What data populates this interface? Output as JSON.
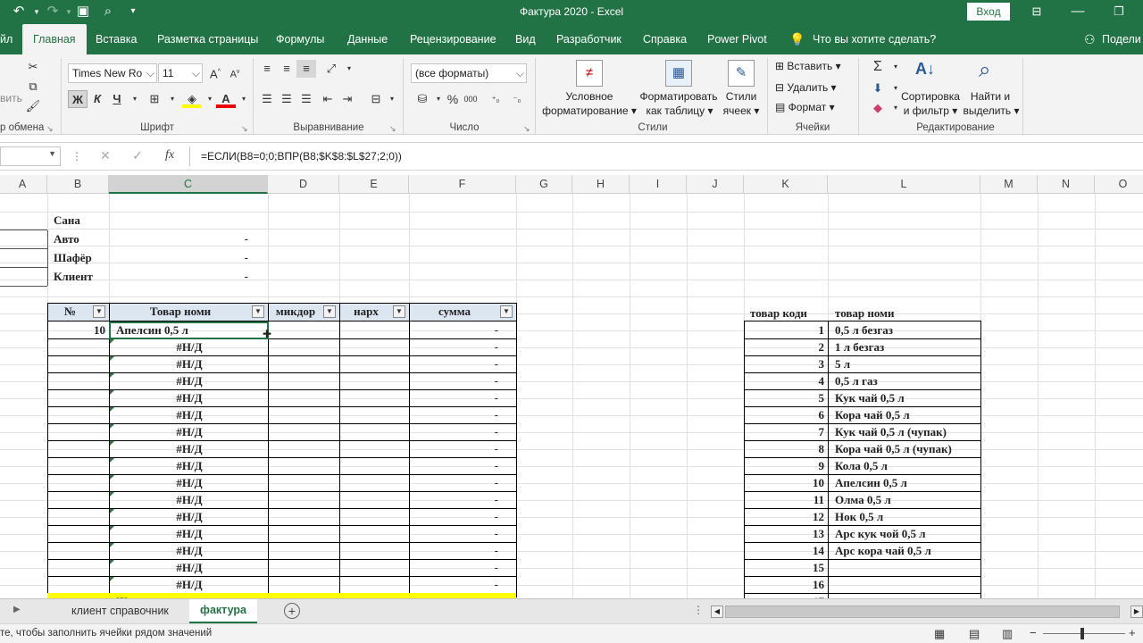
{
  "titlebar": {
    "title": "Фактура 2020  -  Excel",
    "signin": "Вход"
  },
  "ribbon_tabs": {
    "file_partial": "йл",
    "items": [
      "Главная",
      "Вставка",
      "Разметка страницы",
      "Формулы",
      "Данные",
      "Рецензирование",
      "Вид",
      "Разработчик",
      "Справка",
      "Power Pivot"
    ],
    "tellme": "Что вы хотите сделать?",
    "share": "Подели"
  },
  "ribbon": {
    "clipboard": {
      "paste_partial": "вить",
      "group": "р обмена"
    },
    "font": {
      "name": "Times New Ro",
      "size": "11",
      "bold": "Ж",
      "italic": "К",
      "underline": "Ч",
      "group": "Шрифт"
    },
    "alignment": {
      "group": "Выравнивание"
    },
    "number": {
      "format": "(все форматы)",
      "percent": "%",
      "thousands": "000",
      "group": "Число"
    },
    "styles": {
      "conditional": [
        "Условное",
        "форматирование"
      ],
      "as_table": [
        "Форматировать",
        "как таблицу"
      ],
      "cell_styles": [
        "Стили",
        "ячеек"
      ],
      "group": "Стили"
    },
    "cells": {
      "insert": "Вставить",
      "delete": "Удалить",
      "format": "Формат",
      "group": "Ячейки"
    },
    "editing": {
      "sort": [
        "Сортировка",
        "и фильтр"
      ],
      "find": [
        "Найти и",
        "выделить"
      ],
      "group": "Редактирование"
    }
  },
  "formula_bar": {
    "fx": "fx",
    "formula": "=ЕСЛИ(B8=0;0;ВПР(B8;$K$8:$L$27;2;0))"
  },
  "columns": [
    "A",
    "B",
    "C",
    "D",
    "E",
    "F",
    "G",
    "H",
    "I",
    "J",
    "K",
    "L",
    "M",
    "N",
    "O"
  ],
  "header_block": {
    "labels": [
      "Сана",
      "Авто",
      "Шафёр",
      "Клиент"
    ],
    "values": [
      "",
      "-",
      "-",
      "-"
    ]
  },
  "invoice_table": {
    "headers": [
      "№",
      "Товар номи",
      "микдор",
      "нарх",
      "сумма"
    ],
    "first_row": {
      "num": "10",
      "product": "Апелсин 0,5 л",
      "sum": "-"
    },
    "na_value": "#Н/Д",
    "dash_value": "-",
    "na_rows": 15,
    "total_label_partial": "Ж"
  },
  "product_table": {
    "headers": [
      "товар коди",
      "товар номи"
    ],
    "rows": [
      {
        "code": "1",
        "name": "0,5 л безгаз"
      },
      {
        "code": "2",
        "name": "1 л безгаз"
      },
      {
        "code": "3",
        "name": "5 л"
      },
      {
        "code": "4",
        "name": "0,5 л газ"
      },
      {
        "code": "5",
        "name": "Кук чай 0,5 л"
      },
      {
        "code": "6",
        "name": "Кора чай 0,5 л"
      },
      {
        "code": "7",
        "name": "Кук чай 0,5 л (чупак)"
      },
      {
        "code": "8",
        "name": "Кора чай 0,5 л (чупак)"
      },
      {
        "code": "9",
        "name": "Кола 0,5 л"
      },
      {
        "code": "10",
        "name": "Апелсин 0,5 л"
      },
      {
        "code": "11",
        "name": "Олма 0,5 л"
      },
      {
        "code": "12",
        "name": "Нок 0,5 л"
      },
      {
        "code": "13",
        "name": "Арс кук чой 0,5 л"
      },
      {
        "code": "14",
        "name": "Арс кора чай 0,5 л"
      },
      {
        "code": "15",
        "name": ""
      },
      {
        "code": "16",
        "name": ""
      },
      {
        "code": "17",
        "name": ""
      }
    ]
  },
  "sheet_tabs": {
    "items": [
      "клиент справочник",
      "фактура"
    ],
    "active": "фактура"
  },
  "status": {
    "message": "те, чтобы заполнить ячейки рядом значений"
  },
  "colors": {
    "excel_green": "#217346",
    "table_header": "#dce6f1",
    "total_row": "#ffff00",
    "error_marker": "#1e7e34"
  }
}
